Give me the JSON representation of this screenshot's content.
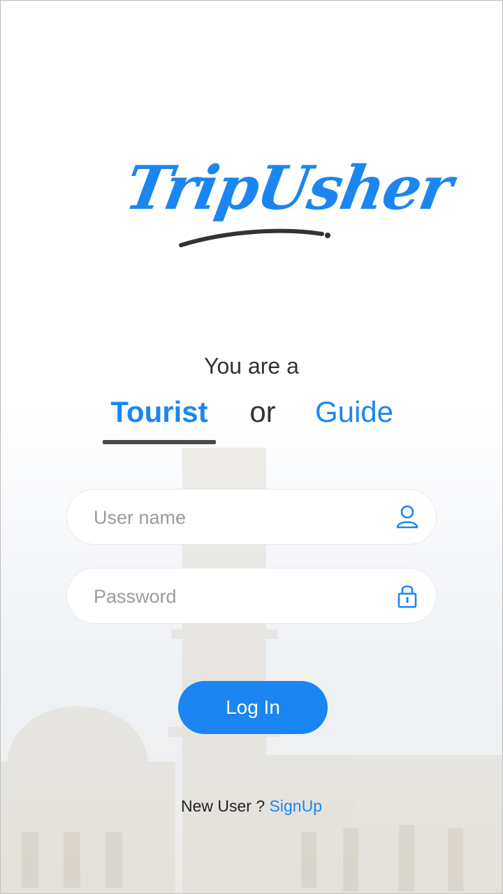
{
  "app": {
    "logo_text": "TripUsher",
    "colors": {
      "accent": "#1b86f2",
      "text": "#333333",
      "underline": "#484848"
    }
  },
  "role_select": {
    "prompt": "You are a",
    "options": [
      "Tourist",
      "Guide"
    ],
    "separator": "or",
    "selected": "Tourist"
  },
  "form": {
    "username": {
      "placeholder": "User name",
      "value": "",
      "icon": "user-icon"
    },
    "password": {
      "placeholder": "Password",
      "value": "",
      "icon": "lock-icon"
    },
    "login_label": "Log In"
  },
  "footer": {
    "new_user_text": "New User ?",
    "signup_label": "SignUp"
  }
}
